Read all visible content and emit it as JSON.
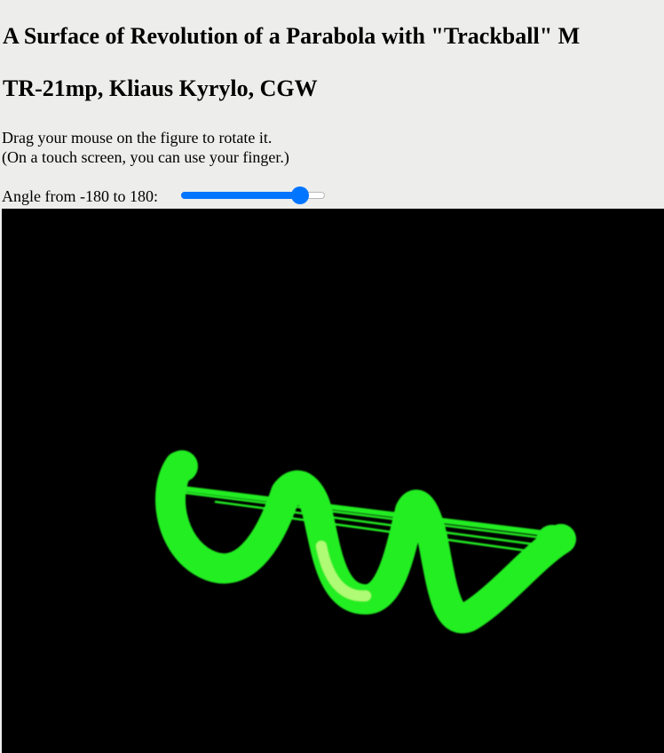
{
  "page": {
    "title": "A Surface of Revolution of a Parabola with \"Trackball\" M",
    "subtitle": "TR-21mp, Kliaus Kyrylo, CGW",
    "instruction_line1": "Drag your mouse on the figure to rotate it.",
    "instruction_line2": "(On a touch screen, you can use your finger.)"
  },
  "angle_control": {
    "label": "Angle from -180 to 180:",
    "min": -180,
    "max": 180,
    "value": 135
  },
  "scene": {
    "background": "#000000",
    "surface_color": "#22ee22",
    "highlight_color": "#e0ff90"
  }
}
